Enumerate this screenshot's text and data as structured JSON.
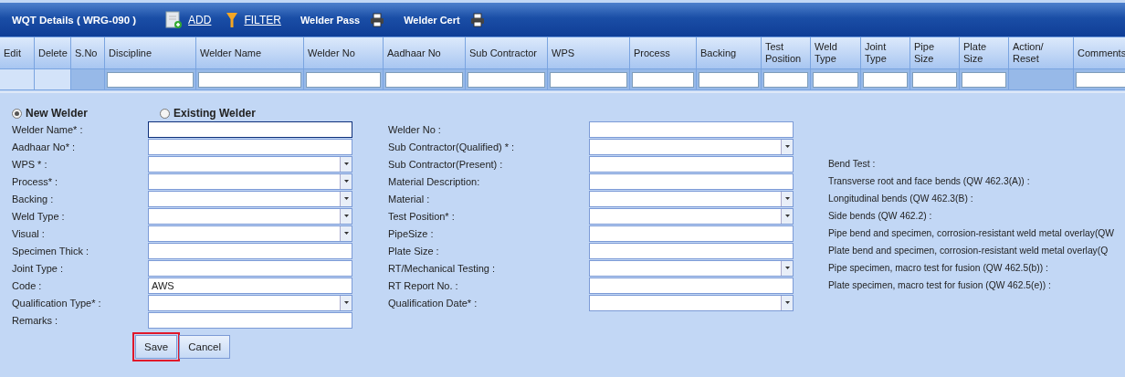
{
  "header": {
    "title": "WQT Details ( WRG-090 )",
    "actions": [
      {
        "kind": "add",
        "label": "ADD"
      },
      {
        "kind": "filter",
        "label": "FILTER"
      },
      {
        "kind": "print",
        "label": "Welder Pass"
      },
      {
        "kind": "print",
        "label": "Welder Cert"
      }
    ]
  },
  "table": {
    "columns": [
      {
        "label": "Edit",
        "kind": "blank"
      },
      {
        "label": "Delete",
        "kind": "blank"
      },
      {
        "label": "S.No",
        "kind": "shaded"
      },
      {
        "label": "Discipline",
        "kind": "input"
      },
      {
        "label": "Welder Name",
        "kind": "input"
      },
      {
        "label": "Welder No",
        "kind": "input"
      },
      {
        "label": "Aadhaar No",
        "kind": "input"
      },
      {
        "label": "Sub Contractor",
        "kind": "input"
      },
      {
        "label": "WPS",
        "kind": "input"
      },
      {
        "label": "Process",
        "kind": "input"
      },
      {
        "label": "Backing",
        "kind": "input"
      },
      {
        "label": "Test Position",
        "kind": "input"
      },
      {
        "label": "Weld Type",
        "kind": "input"
      },
      {
        "label": "Joint Type",
        "kind": "input"
      },
      {
        "label": "Pipe Size",
        "kind": "input"
      },
      {
        "label": "Plate Size",
        "kind": "input"
      },
      {
        "label": "Action/ Reset",
        "kind": "shaded"
      },
      {
        "label": "Comments",
        "kind": "input"
      }
    ]
  },
  "form": {
    "welder_type": [
      {
        "label": "New Welder",
        "selected": true
      },
      {
        "label": "Existing Welder",
        "selected": false
      }
    ],
    "left": [
      {
        "label": "Welder Name* :",
        "kind": "text",
        "focused": true
      },
      {
        "label": "Aadhaar No* :",
        "kind": "text",
        "focused": false
      },
      {
        "label": "WPS * :",
        "kind": "select",
        "focused": false
      },
      {
        "label": "Process* :",
        "kind": "select",
        "focused": false
      },
      {
        "label": "Backing :",
        "kind": "select",
        "focused": false
      },
      {
        "label": "Weld Type :",
        "kind": "select",
        "focused": false
      },
      {
        "label": "Visual :",
        "kind": "select",
        "focused": false
      },
      {
        "label": "Specimen Thick :",
        "kind": "text",
        "focused": false
      },
      {
        "label": "Joint Type :",
        "kind": "text",
        "focused": false
      },
      {
        "label": "Code :",
        "kind": "text",
        "focused": false,
        "value": "AWS"
      },
      {
        "label": "Qualification Type* :",
        "kind": "select",
        "focused": false
      },
      {
        "label": "Remarks :",
        "kind": "text",
        "focused": false
      }
    ],
    "middle": [
      {
        "label": "Welder No :",
        "kind": "text",
        "focused": false
      },
      {
        "label": "Sub Contractor(Qualified) * :",
        "kind": "select",
        "focused": false
      },
      {
        "label": "Sub Contractor(Present) :",
        "kind": "text",
        "focused": false
      },
      {
        "label": "Material Description:",
        "kind": "text",
        "focused": false
      },
      {
        "label": "Material :",
        "kind": "select",
        "focused": false
      },
      {
        "label": "Test Position* :",
        "kind": "select",
        "focused": false
      },
      {
        "label": "PipeSize :",
        "kind": "text",
        "focused": false
      },
      {
        "label": "Plate Size :",
        "kind": "text",
        "focused": false
      },
      {
        "label": "RT/Mechanical Testing :",
        "kind": "select",
        "focused": false
      },
      {
        "label": "RT Report No. :",
        "kind": "text",
        "focused": false
      },
      {
        "label": "Qualification Date* :",
        "kind": "select",
        "focused": false
      }
    ],
    "bend_test": [
      "Bend Test :",
      "Transverse root and face bends (QW 462.3(A)) :",
      "Longitudinal bends (QW 462.3(B) :",
      "Side bends (QW 462.2) :",
      "Pipe bend and specimen, corrosion-resistant weld metal overlay(QW",
      "Plate bend and specimen, corrosion-resistant weld metal overlay(Q",
      "Pipe specimen, macro test for fusion (QW 462.5(b)) :",
      "Plate specimen, macro test for fusion (QW 462.5(e)) :"
    ],
    "buttons": [
      {
        "label": "Save",
        "highlighted": true
      },
      {
        "label": "Cancel",
        "highlighted": false
      }
    ]
  }
}
